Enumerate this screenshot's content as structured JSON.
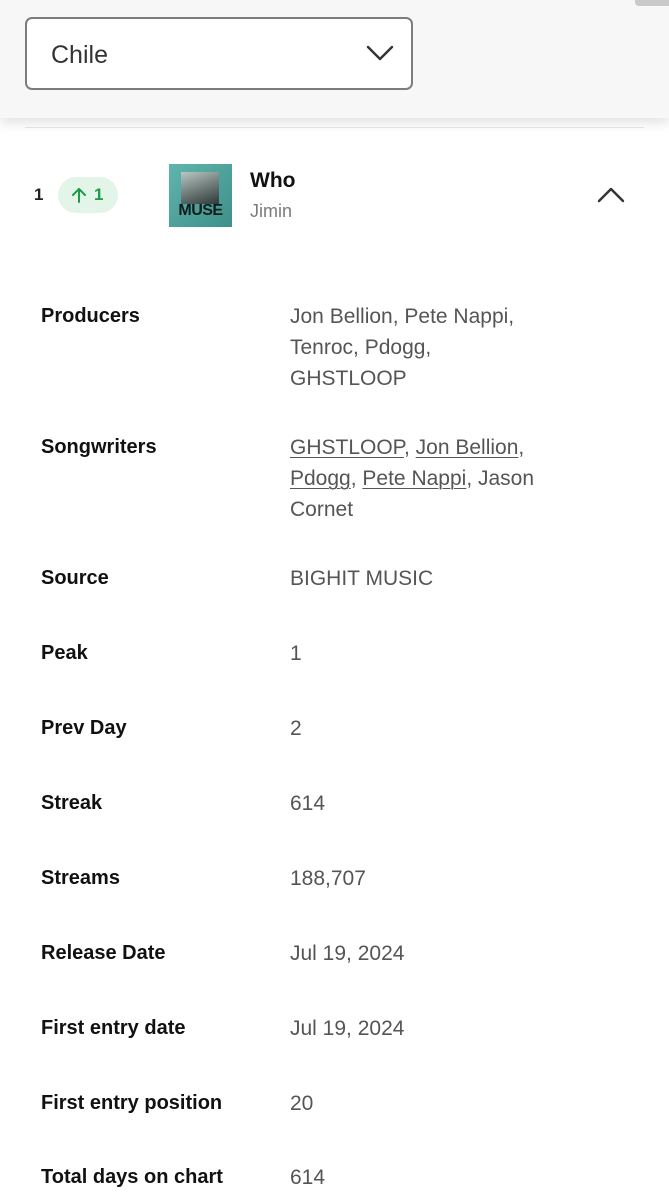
{
  "country_select": {
    "value": "Chile",
    "icon": "chevron-down-icon"
  },
  "track": {
    "rank": "1",
    "movement": "1",
    "movement_direction": "up",
    "movement_color": "#1e9a48",
    "title": "Who",
    "artist": "Jimin",
    "cover_text": "MUSE",
    "collapse_icon": "chevron-up-icon"
  },
  "details": {
    "producers_label": "Producers",
    "producers_value": "Jon Bellion, Pete Nappi, Tenroc, Pdogg, GHSTLOOP",
    "songwriters_label": "Songwriters",
    "songwriters": {
      "w1": "GHSTLOOP",
      "sep1": ", ",
      "w2": "Jon Bellion",
      "sep2": ", ",
      "w3": "Pdogg",
      "sep3": ", ",
      "w4": "Pete Nappi",
      "sep4": ", ",
      "w5": "Jason Cornet"
    },
    "source_label": "Source",
    "source_value": "BIGHIT MUSIC",
    "peak_label": "Peak",
    "peak_value": "1",
    "prev_day_label": "Prev Day",
    "prev_day_value": "2",
    "streak_label": "Streak",
    "streak_value": "614",
    "streams_label": "Streams",
    "streams_value": "188,707",
    "release_date_label": "Release Date",
    "release_date_value": "Jul 19, 2024",
    "first_entry_date_label": "First entry date",
    "first_entry_date_value": "Jul 19, 2024",
    "first_entry_position_label": "First entry position",
    "first_entry_position_value": "20",
    "total_days_label": "Total days on chart",
    "total_days_value": "614"
  }
}
